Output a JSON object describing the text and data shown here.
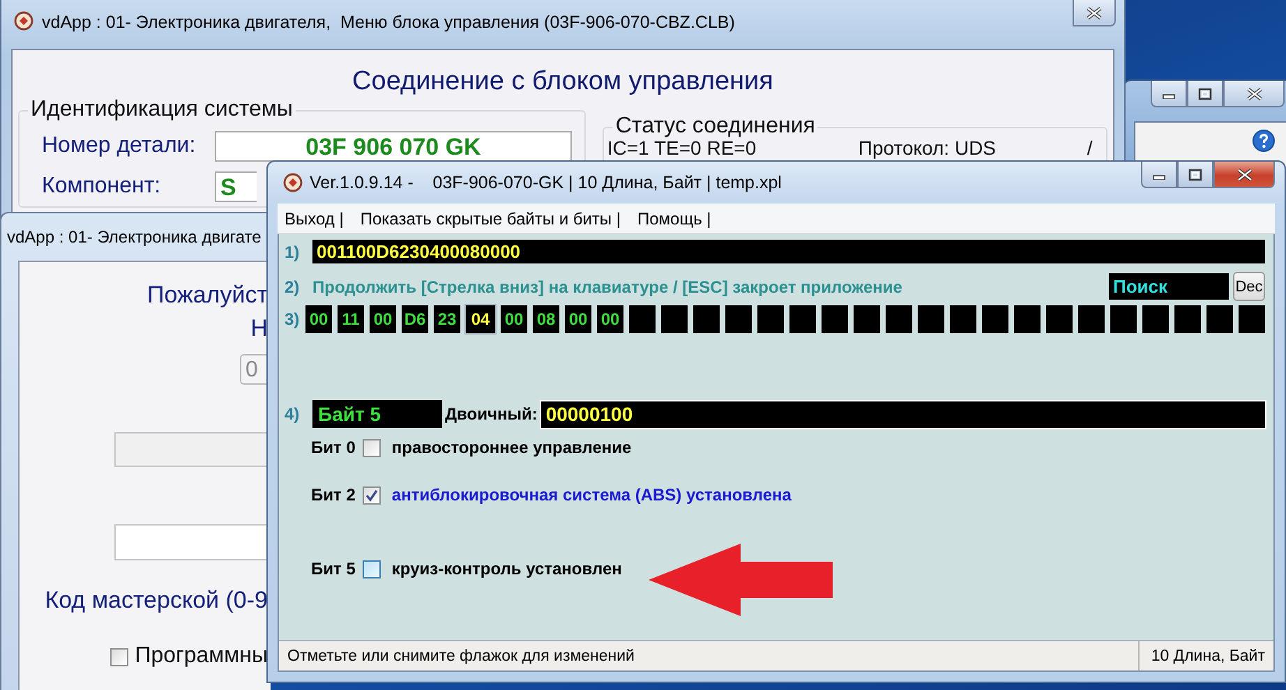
{
  "back_window": {
    "title": "vdApp : 01- Электроника двигателя,  Меню блока управления (03F-906-070-CBZ.CLB)",
    "heading": "Соединение с блоком управления",
    "identification": {
      "title": "Идентификация системы",
      "fields": [
        {
          "label": "Номер детали:",
          "value": "03F 906 070 GK"
        },
        {
          "label": "Компонент:",
          "value": "S"
        }
      ]
    },
    "connection_status": {
      "title": "Статус соединения",
      "counters": "IC=1  TE=0  RE=0",
      "protocol": "Протокол: UDS",
      "indicator": "/"
    }
  },
  "dialog_window": {
    "title": "vdApp : 01- Электроника двигате",
    "prompt_lines": [
      "Пожалуйст",
      "Н"
    ],
    "spin_value": "0",
    "workshop_label": "Код мастерской (0-9",
    "option": {
      "label": "Программны",
      "checked": false
    }
  },
  "main_window": {
    "title": "Ver.1.0.9.14 -    03F-906-070-GK | 10 Длина, Байт | temp.xpl",
    "menu": [
      {
        "label": "Выход |"
      },
      {
        "label": "Показать скрытые байты и биты |"
      },
      {
        "label": "Помощь |"
      }
    ],
    "row_numbers": [
      "1)",
      "2)",
      "3)",
      "4)"
    ],
    "hex_string": "001100D6230400080000",
    "hint": "Продолжить [Стрелка вниз] на клавиатуре / [ESC] закроет приложение",
    "search": "Поиск",
    "dec_button": "Dec",
    "bytes": [
      {
        "value": "00",
        "selected": false
      },
      {
        "value": "11",
        "selected": false
      },
      {
        "value": "00",
        "selected": false
      },
      {
        "value": "D6",
        "selected": false
      },
      {
        "value": "23",
        "selected": false
      },
      {
        "value": "04",
        "selected": true
      },
      {
        "value": "00",
        "selected": false
      },
      {
        "value": "08",
        "selected": false
      },
      {
        "value": "00",
        "selected": false
      },
      {
        "value": "00",
        "selected": false
      },
      {
        "selected": false
      },
      {
        "selected": false
      },
      {
        "selected": false
      },
      {
        "selected": false
      },
      {
        "selected": false
      },
      {
        "selected": false
      },
      {
        "selected": false
      },
      {
        "selected": false
      },
      {
        "selected": false
      },
      {
        "selected": false
      },
      {
        "selected": false
      },
      {
        "selected": false
      },
      {
        "selected": false
      },
      {
        "selected": false
      },
      {
        "selected": false
      },
      {
        "selected": false
      },
      {
        "selected": false
      },
      {
        "selected": false
      },
      {
        "selected": false
      },
      {
        "selected": false
      }
    ],
    "byte_label": "Байт 5",
    "binary_label": "Двоичный:",
    "binary_value": "00000100",
    "bits": [
      {
        "label": "Бит 0",
        "text": "правостороннее управление",
        "checked": false
      },
      {
        "label": "Бит 2",
        "text": "антиблокировочная система (ABS) установлена",
        "checked": true
      },
      {
        "label": "Бит 5",
        "text": "круиз-контроль установлен",
        "checked": false
      }
    ],
    "status_bar": {
      "message": "Отметьте или снимите флажок для изменений",
      "info": "10 Длина, Байт"
    }
  }
}
